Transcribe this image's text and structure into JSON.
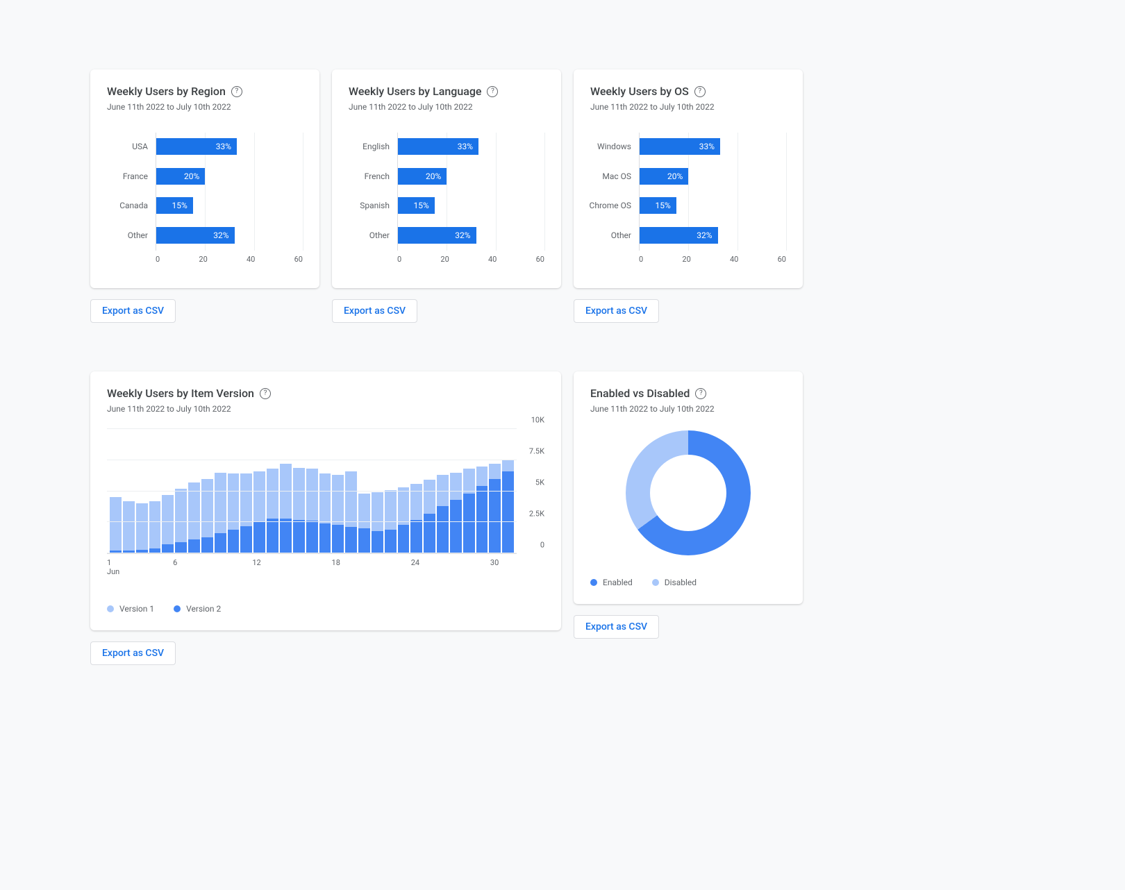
{
  "date_range": "June 11th 2022 to July 10th 2022",
  "export_label": "Export as CSV",
  "cards": {
    "region": {
      "title": "Weekly Users by Region"
    },
    "language": {
      "title": "Weekly Users by Language"
    },
    "os": {
      "title": "Weekly Users by OS"
    },
    "version": {
      "title": "Weekly Users by Item Version"
    },
    "enabled": {
      "title": "Enabled vs Disabled"
    }
  },
  "legend": {
    "version1": "Version 1",
    "version2": "Version 2",
    "enabled": "Enabled",
    "disabled": "Disabled"
  },
  "chart_data": [
    {
      "id": "region",
      "type": "bar",
      "orientation": "horizontal",
      "categories": [
        "USA",
        "France",
        "Canada",
        "Other"
      ],
      "values": [
        33,
        20,
        15,
        32
      ],
      "value_labels": [
        "33%",
        "20%",
        "15%",
        "32%"
      ],
      "xlim": [
        0,
        60
      ],
      "xticks": [
        0,
        20,
        40,
        60
      ]
    },
    {
      "id": "language",
      "type": "bar",
      "orientation": "horizontal",
      "categories": [
        "English",
        "French",
        "Spanish",
        "Other"
      ],
      "values": [
        33,
        20,
        15,
        32
      ],
      "value_labels": [
        "33%",
        "20%",
        "15%",
        "32%"
      ],
      "xlim": [
        0,
        60
      ],
      "xticks": [
        0,
        20,
        40,
        60
      ]
    },
    {
      "id": "os",
      "type": "bar",
      "orientation": "horizontal",
      "categories": [
        "Windows",
        "Mac OS",
        "Chrome OS",
        "Other"
      ],
      "values": [
        33,
        20,
        15,
        32
      ],
      "value_labels": [
        "33%",
        "20%",
        "15%",
        "32%"
      ],
      "xlim": [
        0,
        60
      ],
      "xticks": [
        0,
        20,
        40,
        60
      ]
    },
    {
      "id": "version",
      "type": "bar",
      "stacked": true,
      "ylim": [
        0,
        10000
      ],
      "yticks": [
        0,
        2500,
        5000,
        7500,
        10000
      ],
      "ytick_labels": [
        "0",
        "2.5K",
        "5K",
        "7.5K",
        "10K"
      ],
      "x": [
        1,
        2,
        3,
        4,
        5,
        6,
        7,
        8,
        9,
        10,
        11,
        12,
        13,
        14,
        15,
        16,
        17,
        18,
        19,
        20,
        21,
        22,
        23,
        24,
        25,
        26,
        27,
        28,
        29,
        30,
        31
      ],
      "xtick_labels": [
        "1 Jun",
        "",
        "",
        "",
        "",
        "6",
        "",
        "",
        "",
        "",
        "",
        "12",
        "",
        "",
        "",
        "",
        "",
        "18",
        "",
        "",
        "",
        "",
        "",
        "24",
        "",
        "",
        "",
        "",
        "",
        "30",
        ""
      ],
      "series": [
        {
          "name": "Version 2",
          "color": "#4285f4",
          "values": [
            200,
            200,
            300,
            400,
            700,
            900,
            1100,
            1300,
            1600,
            1900,
            2200,
            2500,
            2800,
            2800,
            2700,
            2600,
            2400,
            2300,
            2100,
            2000,
            1800,
            1900,
            2300,
            2700,
            3200,
            3800,
            4300,
            4800,
            5400,
            6000,
            6600
          ]
        },
        {
          "name": "Version 1",
          "color": "#a8c7fa",
          "values": [
            4300,
            4000,
            3700,
            3800,
            4000,
            4300,
            4600,
            4700,
            4900,
            4500,
            4200,
            4100,
            4000,
            4400,
            4200,
            4200,
            4000,
            4000,
            4500,
            2800,
            3100,
            3200,
            3000,
            2900,
            2700,
            2500,
            2200,
            2000,
            1600,
            1200,
            900
          ]
        }
      ]
    },
    {
      "id": "enabled",
      "type": "pie",
      "donut": true,
      "categories": [
        "Enabled",
        "Disabled"
      ],
      "values": [
        65,
        35
      ],
      "colors": [
        "#4285f4",
        "#a8c7fa"
      ]
    }
  ]
}
